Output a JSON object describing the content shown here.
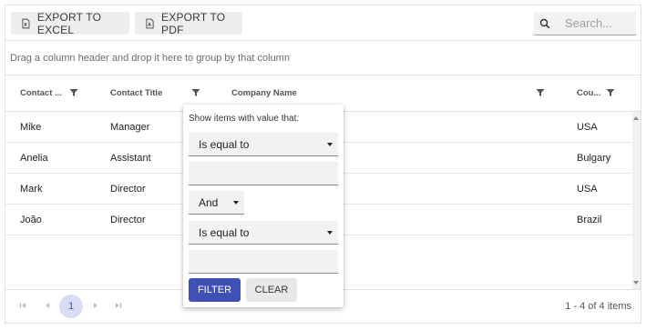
{
  "toolbar": {
    "export_excel_label": "EXPORT TO EXCEL",
    "export_pdf_label": "EXPORT TO PDF",
    "search_placeholder": "Search..."
  },
  "group_panel": {
    "hint": "Drag a column header and drop it here to group by that column"
  },
  "columns": [
    {
      "label": "Contact ..."
    },
    {
      "label": "Contact Title"
    },
    {
      "label": "Company Name"
    },
    {
      "label": "Cou..."
    }
  ],
  "rows": [
    {
      "contact": "Mike",
      "title": "Manager",
      "country": "USA"
    },
    {
      "contact": "Anelia",
      "title": "Assistant",
      "country": "Bulgary"
    },
    {
      "contact": "Mark",
      "title": "Director",
      "country": "USA"
    },
    {
      "contact": "João",
      "title": "Director",
      "country": "Brazil"
    }
  ],
  "pager": {
    "current_page": "1",
    "info": "1 - 4 of 4 items"
  },
  "filter_menu": {
    "title": "Show items with value that:",
    "operator1": "Is equal to",
    "value1": "",
    "logic": "And",
    "operator2": "Is equal to",
    "value2": "",
    "filter_label": "FILTER",
    "clear_label": "CLEAR"
  },
  "colors": {
    "accent": "#3f51b5",
    "page_highlight": "#d9dcf2",
    "button_bg": "#eeeeee"
  },
  "icons": {
    "export_excel": "excel-file-icon",
    "export_pdf": "pdf-file-icon",
    "search": "search-icon",
    "filter": "filter-icon"
  }
}
